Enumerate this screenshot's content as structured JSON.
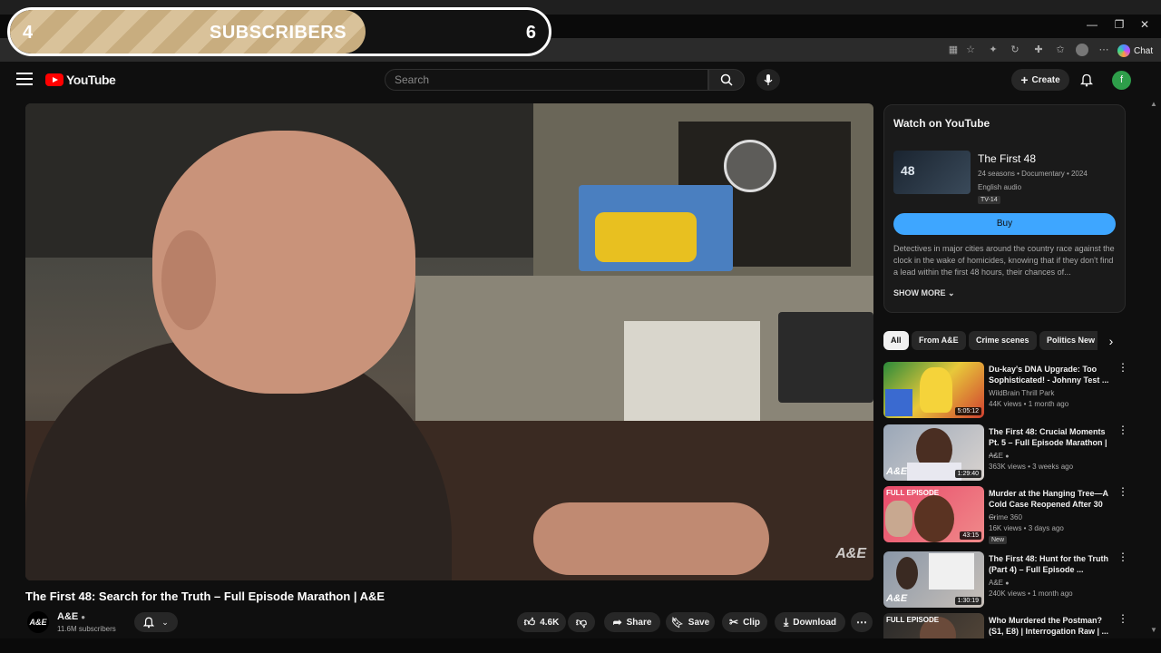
{
  "browser": {
    "window_controls": [
      "—",
      "❐",
      "✕"
    ],
    "chat_label": "Chat"
  },
  "overlay": {
    "left_number": "4",
    "label": "SUBSCRIBERS",
    "right_number": "6",
    "progress_fraction": 0.66
  },
  "header": {
    "logo_text": "YouTube",
    "search_placeholder": "Search",
    "create_label": "Create",
    "avatar_letter": "f"
  },
  "video": {
    "title": "The First 48: Search for the Truth – Full Episode Marathon | A&E",
    "watermark": "A&E",
    "channel_logo": "A&E",
    "channel_name": "A&E",
    "channel_subs": "11.6M subscribers",
    "likes": "4.6K",
    "actions": {
      "share": "Share",
      "save": "Save",
      "clip": "Clip",
      "download": "Download"
    }
  },
  "watch_card": {
    "heading": "Watch on YouTube",
    "thumb_text": "48",
    "show_title": "The First 48",
    "meta": "24 seasons • Documentary • 2024",
    "audio": "English audio",
    "rating": "TV-14",
    "buy_label": "Buy",
    "description": "Detectives in major cities around the country race against the clock in the wake of homicides, knowing that if they don't find a lead within the first 48 hours, their chances of...",
    "show_more": "SHOW MORE"
  },
  "chips": [
    "All",
    "From A&E",
    "Crime scenes",
    "Politics New"
  ],
  "recommendations": [
    {
      "title": "Du-kay's DNA Upgrade: Too Sophisticated! - Johnny Test ...",
      "channel": "WildBrain Thrill Park",
      "stats": "44K views • 1 month ago",
      "duration": "5:05:12",
      "thumb_label": "",
      "verified": false,
      "new": ""
    },
    {
      "title": "The First 48: Crucial Moments Pt. 5 – Full Episode Marathon | ...",
      "channel": "A&E",
      "stats": "363K views • 3 weeks ago",
      "duration": "1:29:40",
      "thumb_label": "A&E",
      "verified": true,
      "new": ""
    },
    {
      "title": "Murder at the Hanging Tree—A Cold Case Reopened After 30 ...",
      "channel": "Crime 360",
      "stats": "16K views • 3 days ago",
      "duration": "43:15",
      "thumb_label": "FULL EPISODE",
      "verified": false,
      "new": "New"
    },
    {
      "title": "The First 48: Hunt for the Truth (Part 4) – Full Episode ...",
      "channel": "A&E",
      "stats": "240K views • 1 month ago",
      "duration": "1:30:19",
      "thumb_label": "A&E",
      "verified": true,
      "new": ""
    },
    {
      "title": "Who Murdered the Postman? (S1, E8) | Interrogation Raw | ...",
      "channel": "",
      "stats": "",
      "duration": "",
      "thumb_label": "FULL EPISODE",
      "verified": false,
      "new": ""
    }
  ],
  "colors": {
    "accent_blue": "#3ea6ff",
    "brand_red": "#ff0000",
    "overlay_gold": "#c8ad7f"
  }
}
